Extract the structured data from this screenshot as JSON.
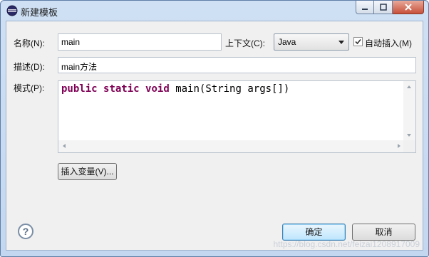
{
  "window": {
    "title": "新建模板"
  },
  "form": {
    "name_label": "名称(N):",
    "name_value": "main",
    "context_label": "上下文(C):",
    "context_value": "Java",
    "auto_insert_label": "自动插入(M)",
    "desc_label": "描述(D):",
    "desc_value": "main方法",
    "pattern_label": "模式(P):",
    "code": {
      "kw1": "public",
      "kw2": "static",
      "kw3": "void",
      "rest": "main(String args[])"
    }
  },
  "buttons": {
    "insert_variable": "插入变量(V)...",
    "ok": "确定",
    "cancel": "取消"
  },
  "watermark": "https://blog.csdn.net/feizai1208917009",
  "colors": {
    "keyword": "#7f0055",
    "default_button_border": "#3c7fb1"
  }
}
